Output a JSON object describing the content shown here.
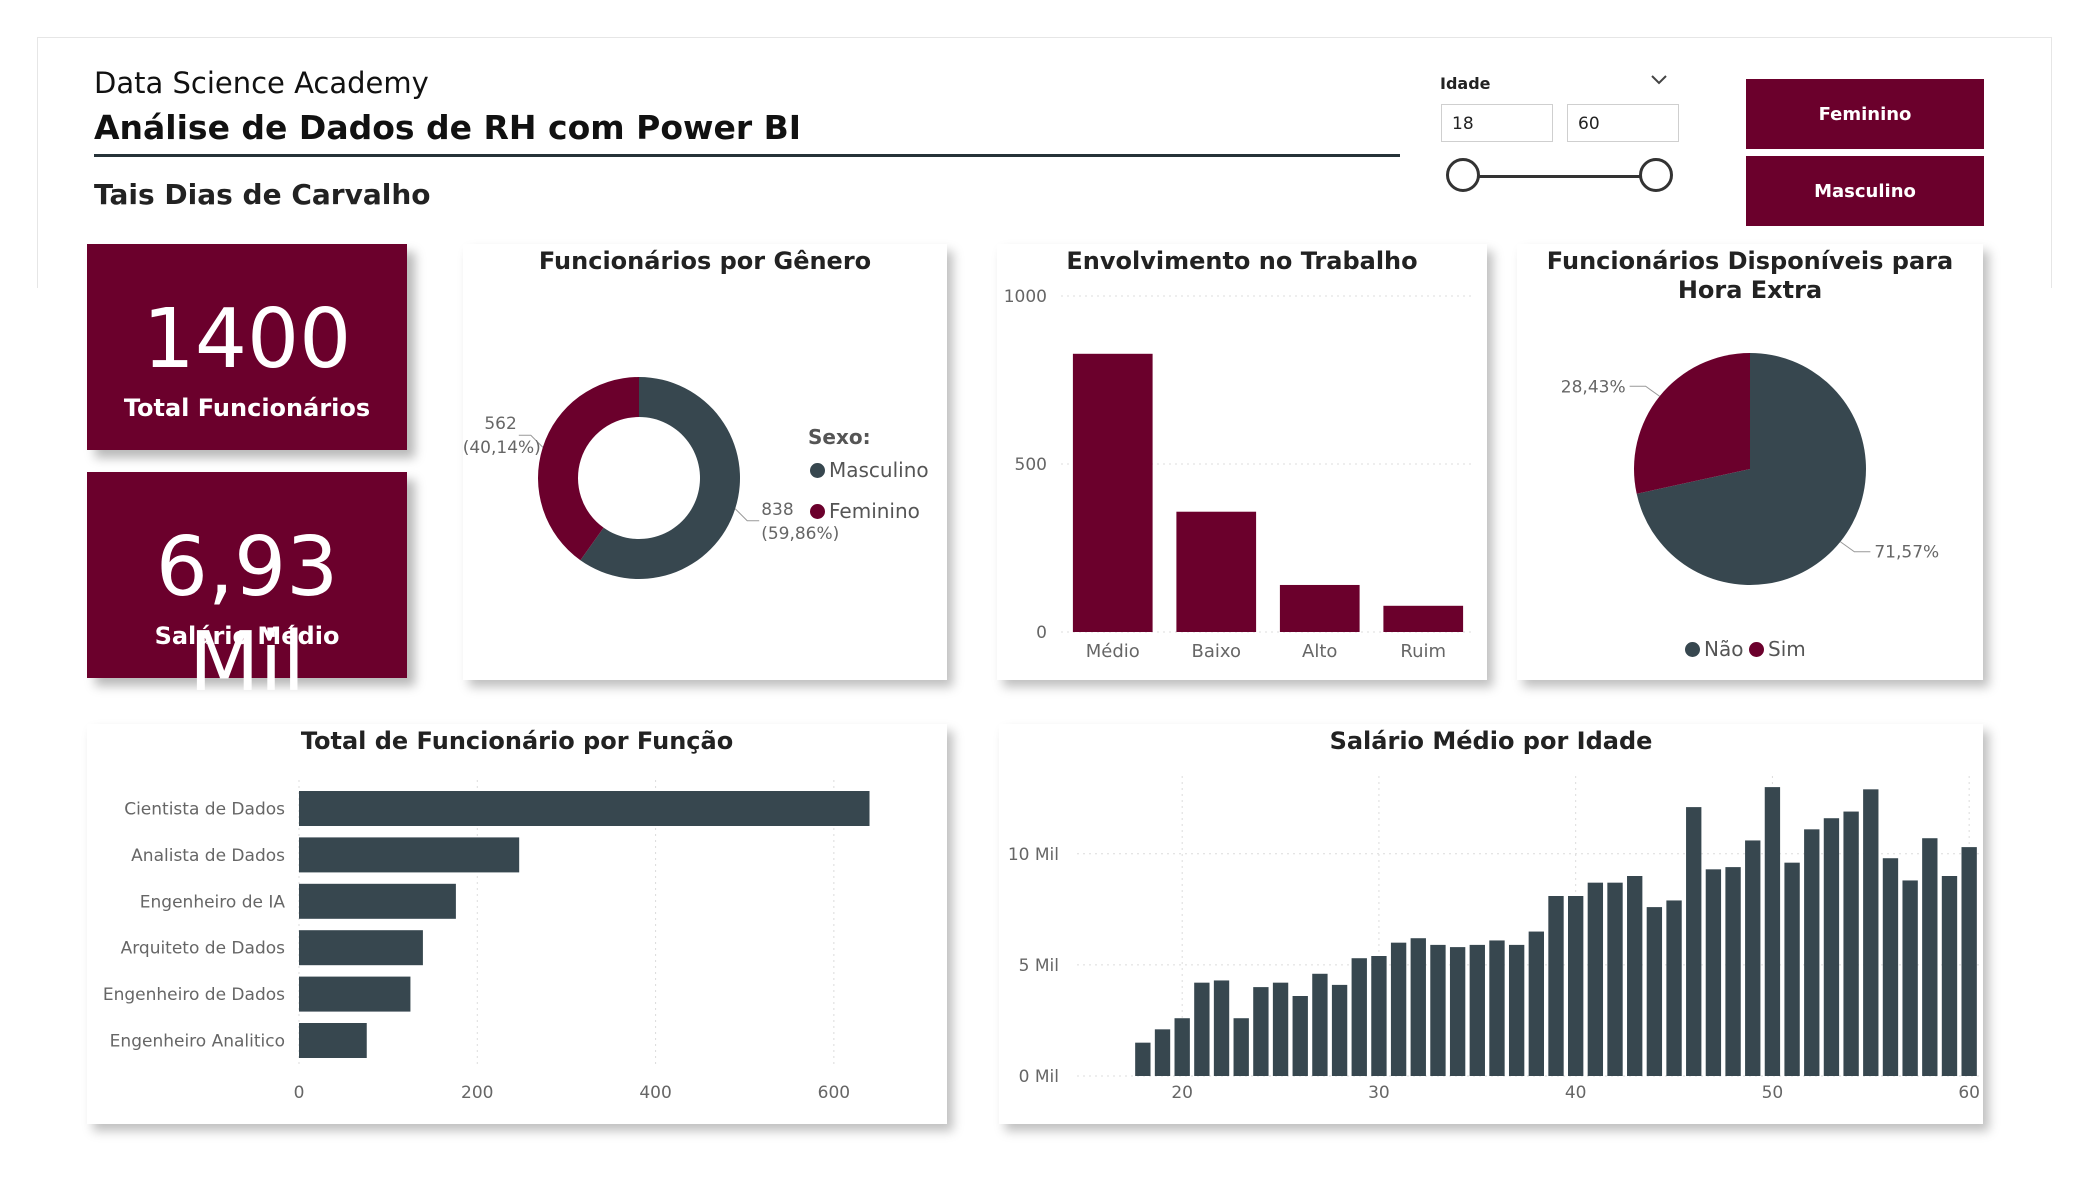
{
  "header": {
    "org": "Data Science Academy",
    "title": "Análise de Dados de RH com Power BI",
    "author": "Tais Dias de Carvalho"
  },
  "slicer": {
    "label": "Idade",
    "min_value": "18",
    "max_value": "60",
    "chevron_icon": "chevron-down-icon"
  },
  "buttons": {
    "female": "Feminino",
    "male": "Masculino"
  },
  "kpis": {
    "total_value": "1400",
    "total_label": "Total Funcionários",
    "salary_value": "6,93 Mil",
    "salary_label": "Salário Médio"
  },
  "colors": {
    "wine": "#6b002c",
    "slate": "#37474f"
  },
  "chart_data": [
    {
      "id": "gender",
      "type": "pie",
      "donut": true,
      "title": "Funcionários por Gênero",
      "legend_title": "Sexo:",
      "slices": [
        {
          "name": "Masculino",
          "value": 838,
          "label": "838",
          "pct": "(59,86%)",
          "color": "#37474f"
        },
        {
          "name": "Feminino",
          "value": 562,
          "label": "562",
          "pct": "(40,14%)",
          "color": "#6b002c"
        }
      ]
    },
    {
      "id": "involvement",
      "type": "bar",
      "title": "Envolvimento no Trabalho",
      "categories": [
        "Médio",
        "Baixo",
        "Alto",
        "Ruim"
      ],
      "values": [
        828,
        358,
        140,
        78
      ],
      "ylim": [
        0,
        1000
      ],
      "yticks": [
        "0",
        "500",
        "1000"
      ],
      "color": "#6b002c"
    },
    {
      "id": "overtime",
      "type": "pie",
      "title": "Funcionários Disponíveis para Hora Extra",
      "slices": [
        {
          "name": "Não",
          "value": 71.57,
          "label": "71,57%",
          "color": "#37474f"
        },
        {
          "name": "Sim",
          "value": 28.43,
          "label": "28,43%",
          "color": "#6b002c"
        }
      ]
    },
    {
      "id": "roles",
      "type": "bar",
      "orientation": "horizontal",
      "title": "Total de Funcionário por Função",
      "categories": [
        "Cientista de Dados",
        "Analista de Dados",
        "Engenheiro de IA",
        "Arquiteto de Dados",
        "Engenheiro de Dados",
        "Engenheiro Analitico"
      ],
      "values": [
        640,
        247,
        176,
        139,
        125,
        76
      ],
      "xlim": [
        0,
        700
      ],
      "xticks": [
        "0",
        "200",
        "400",
        "600"
      ],
      "color": "#37474f"
    },
    {
      "id": "salary_age",
      "type": "bar",
      "title": "Salário Médio por Idade",
      "x": [
        18,
        19,
        20,
        21,
        22,
        23,
        24,
        25,
        26,
        27,
        28,
        29,
        30,
        31,
        32,
        33,
        34,
        35,
        36,
        37,
        38,
        39,
        40,
        41,
        42,
        43,
        44,
        45,
        46,
        47,
        48,
        49,
        50,
        51,
        52,
        53,
        54,
        55,
        56,
        57,
        58,
        59,
        60
      ],
      "values": [
        1.5,
        2.1,
        2.6,
        4.2,
        4.3,
        2.6,
        4.0,
        4.2,
        3.6,
        4.6,
        4.1,
        5.3,
        5.4,
        6.0,
        6.2,
        5.9,
        5.8,
        5.9,
        6.1,
        5.9,
        6.5,
        8.1,
        8.1,
        8.7,
        8.7,
        9.0,
        7.6,
        7.9,
        12.1,
        9.3,
        9.4,
        10.6,
        13.0,
        9.6,
        11.1,
        11.6,
        11.9,
        12.9,
        9.8,
        8.8,
        10.7,
        9.0,
        10.3
      ],
      "ylim": [
        0,
        13.5
      ],
      "yticks": [
        "0 Mil",
        "5 Mil",
        "10 Mil"
      ],
      "xticks": [
        "20",
        "30",
        "40",
        "50",
        "60"
      ],
      "ylabel_unit": "Mil",
      "color": "#37474f"
    }
  ]
}
